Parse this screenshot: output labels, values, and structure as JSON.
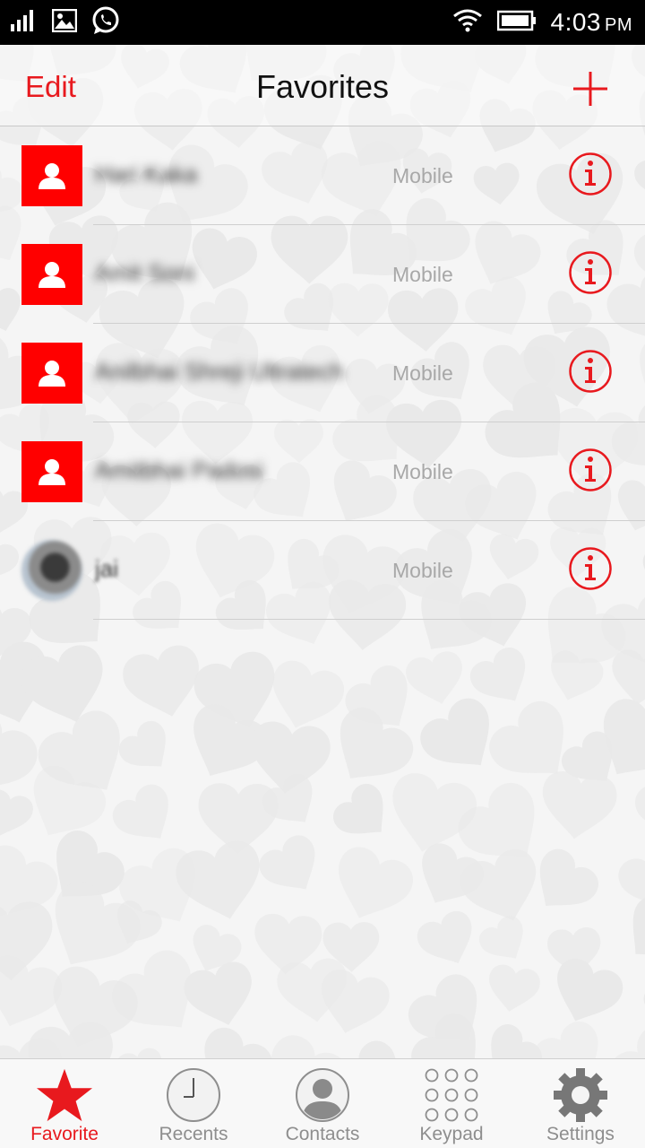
{
  "status_bar": {
    "time": "4:03",
    "ampm": "PM",
    "icons": [
      "signal-icon",
      "image-notification-icon",
      "whatsapp-icon",
      "wifi-icon",
      "battery-icon"
    ]
  },
  "header": {
    "edit_label": "Edit",
    "title": "Favorites",
    "add_icon": "plus-icon"
  },
  "favorites": [
    {
      "name": "Hari Kaka",
      "type": "Mobile",
      "avatar": "default"
    },
    {
      "name": "Amit Soni",
      "type": "Mobile",
      "avatar": "default"
    },
    {
      "name": "Anilbhai Shreji Ultratech",
      "type": "Mobile",
      "avatar": "default"
    },
    {
      "name": "Amitbhai Padosi",
      "type": "Mobile",
      "avatar": "default"
    },
    {
      "name": "jai",
      "type": "Mobile",
      "avatar": "photo"
    }
  ],
  "tabs": [
    {
      "label": "Favorite",
      "icon": "star-icon",
      "active": true
    },
    {
      "label": "Recents",
      "icon": "clock-icon",
      "active": false
    },
    {
      "label": "Contacts",
      "icon": "contact-icon",
      "active": false
    },
    {
      "label": "Keypad",
      "icon": "keypad-icon",
      "active": false
    },
    {
      "label": "Settings",
      "icon": "gear-icon",
      "active": false
    }
  ],
  "colors": {
    "accent": "#e8191e",
    "avatar_bg": "#ff0000",
    "muted_text": "#a8a8a8"
  }
}
